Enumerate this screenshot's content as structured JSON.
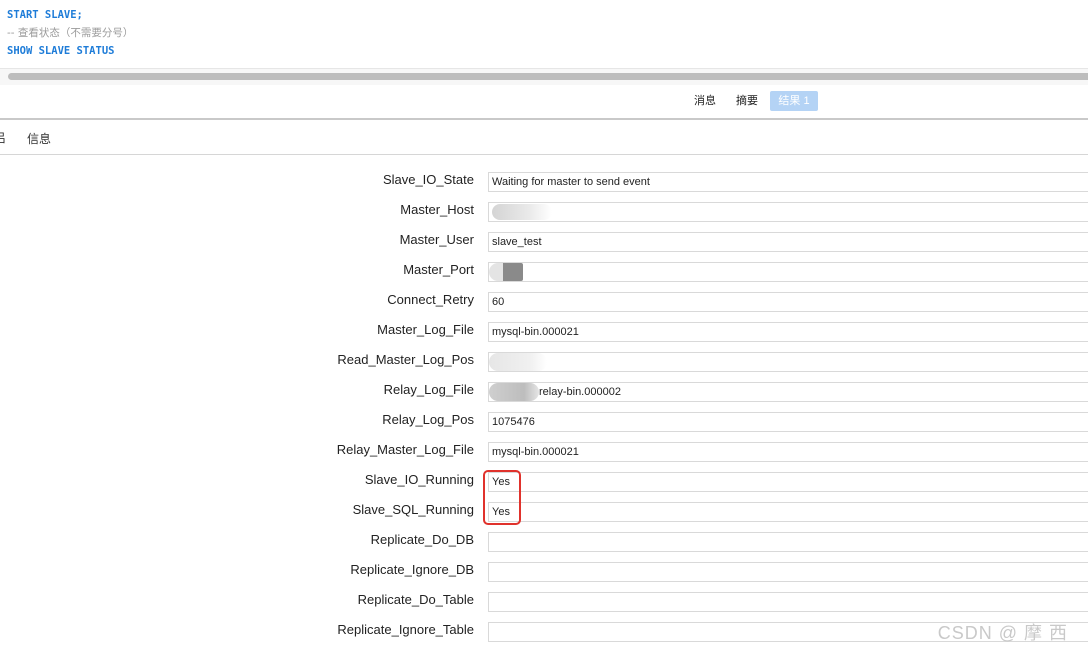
{
  "editor": {
    "line1": "START SLAVE;",
    "line2_prefix": "-- ",
    "line2_comment": "查看状态（不需要分号）",
    "line3": "SHOW SLAVE STATUS"
  },
  "tabs": {
    "messages": "消息",
    "summary": "摘要",
    "result": "结果 1"
  },
  "subtabs": {
    "left_edge": "吕",
    "info": "信息"
  },
  "fields": [
    {
      "label": "Slave_IO_State",
      "value": "Waiting for master to send event"
    },
    {
      "label": "Master_Host",
      "value": ""
    },
    {
      "label": "Master_User",
      "value": "slave_test"
    },
    {
      "label": "Master_Port",
      "value": ""
    },
    {
      "label": "Connect_Retry",
      "value": "60"
    },
    {
      "label": "Master_Log_File",
      "value": "mysql-bin.000021"
    },
    {
      "label": "Read_Master_Log_Pos",
      "value": ""
    },
    {
      "label": "Relay_Log_File",
      "value": "relay-bin.000002"
    },
    {
      "label": "Relay_Log_Pos",
      "value": "1075476"
    },
    {
      "label": "Relay_Master_Log_File",
      "value": "mysql-bin.000021"
    },
    {
      "label": "Slave_IO_Running",
      "value": "Yes"
    },
    {
      "label": "Slave_SQL_Running",
      "value": "Yes"
    },
    {
      "label": "Replicate_Do_DB",
      "value": ""
    },
    {
      "label": "Replicate_Ignore_DB",
      "value": ""
    },
    {
      "label": "Replicate_Do_Table",
      "value": ""
    },
    {
      "label": "Replicate_Ignore_Table",
      "value": ""
    }
  ],
  "watermark": "CSDN @ 摩 西",
  "colors": {
    "highlight": "#e0322c",
    "keyword": "#1e7cd8",
    "active_tab": "#b4d3f5"
  }
}
